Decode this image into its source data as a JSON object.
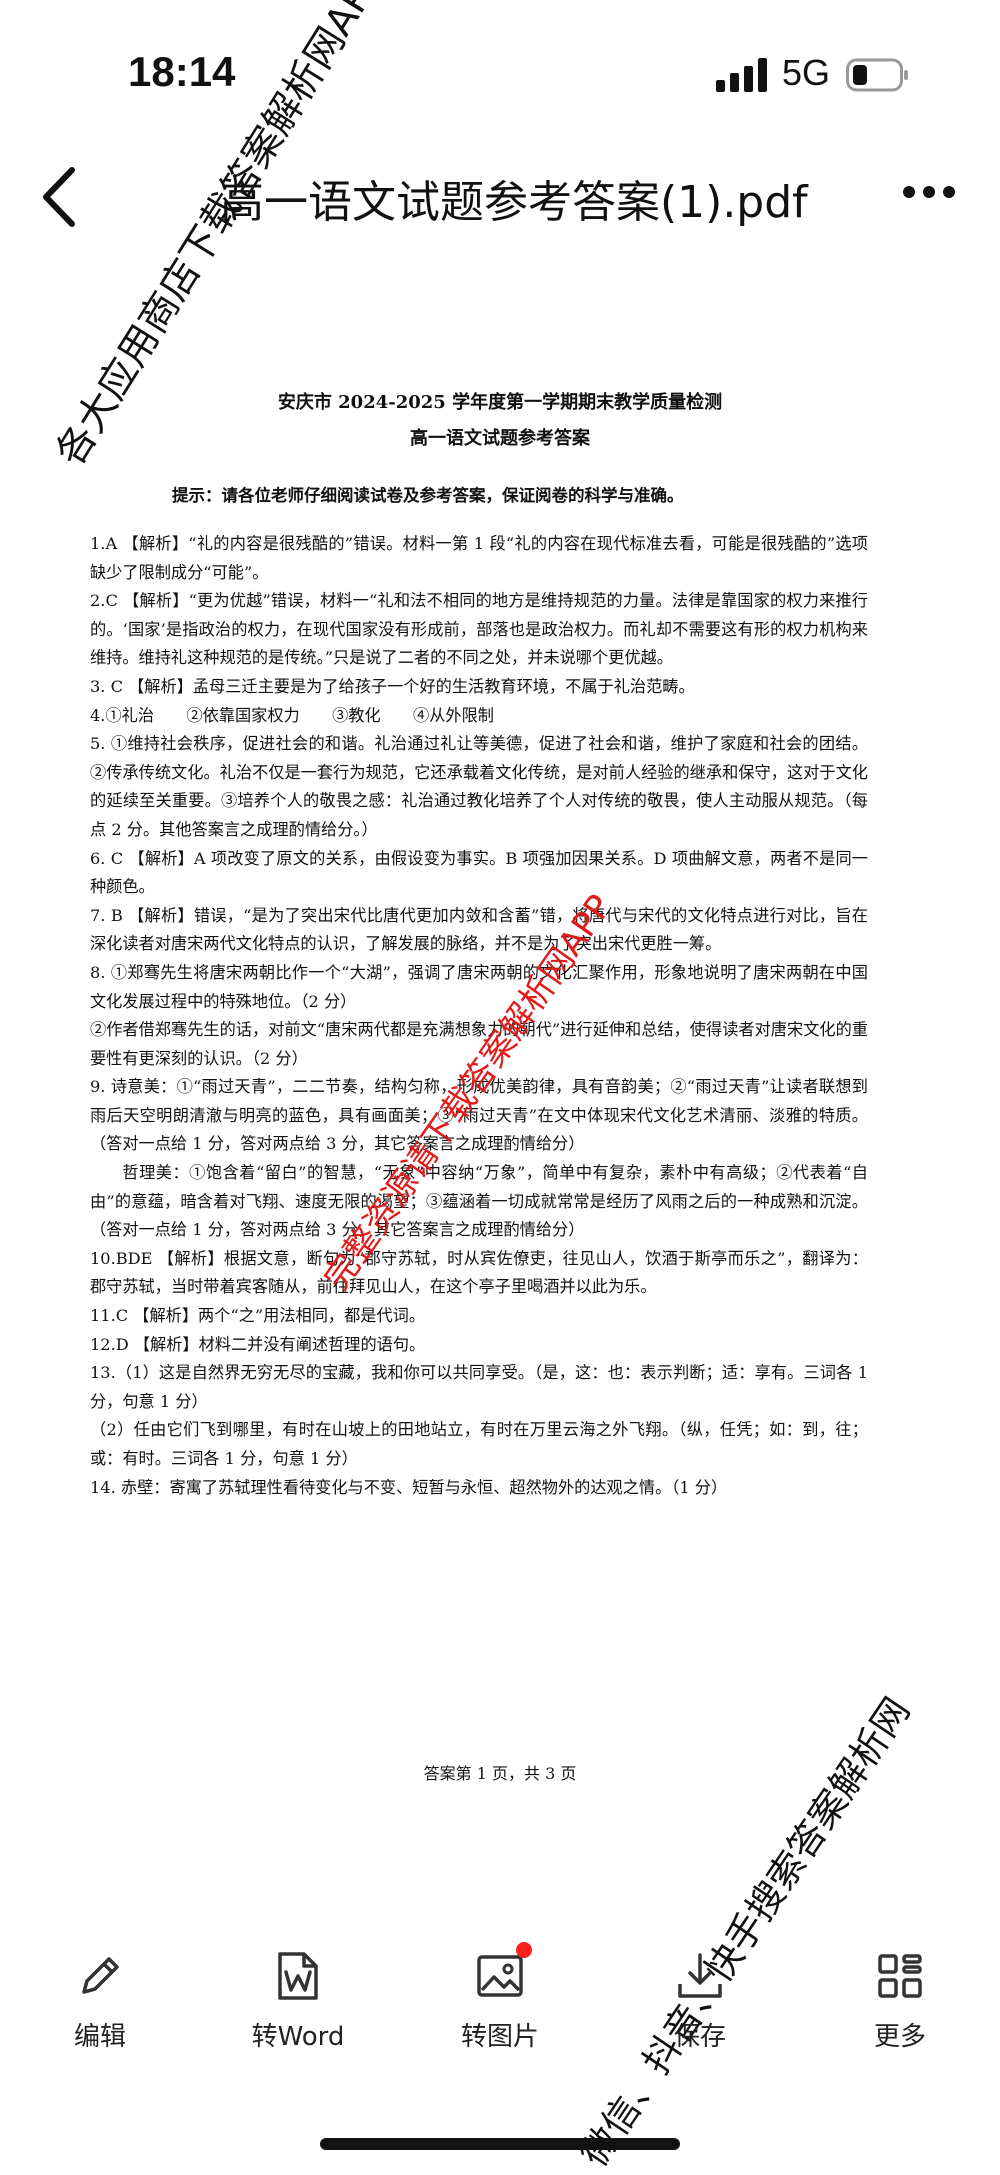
{
  "status_bar": {
    "time": "18:14",
    "network": "5G"
  },
  "header": {
    "title": "高一语文试题参考答案(1).pdf"
  },
  "document": {
    "heading1": "安庆市 2024-2025 学年度第一学期期末教学质量检测",
    "heading2": "高一语文试题参考答案",
    "tip": "提示：请各位老师仔细阅读试卷及参考答案，保证阅卷的科学与准确。",
    "paragraphs": [
      "1.A 【解析】“礼的内容是很残酷的”错误。材料一第 1 段“礼的内容在现代标准去看，可能是很残酷的”选项缺少了限制成分“可能”。",
      "2.C 【解析】“更为优越”错误，材料一“礼和法不相同的地方是维持规范的力量。法律是靠国家的权力来推行的。‘国家’是指政治的权力，在现代国家没有形成前，部落也是政治权力。而礼却不需要这有形的权力机构来维持。维持礼这种规范的是传统。”只是说了二者的不同之处，并未说哪个更优越。",
      "3. C 【解析】孟母三迁主要是为了给孩子一个好的生活教育环境，不属于礼治范畴。",
      "4.①礼治　　②依靠国家权力　　③教化　　④从外限制",
      "5. ①维持社会秩序，促进社会的和谐。礼治通过礼让等美德，促进了社会和谐，维护了家庭和社会的团结。②传承传统文化。礼治不仅是一套行为规范，它还承载着文化传统，是对前人经验的继承和保守，这对于文化的延续至关重要。③培养个人的敬畏之感：礼治通过教化培养了个人对传统的敬畏，使人主动服从规范。（每点 2 分。其他答案言之成理酌情给分。）",
      "6. C 【解析】A 项改变了原文的关系，由假设变为事实。B 项强加因果关系。D 项曲解文意，两者不是同一种颜色。",
      "7. B 【解析】错误，“是为了突出宋代比唐代更加内敛和含蓄”错，将唐代与宋代的文化特点进行对比，旨在深化读者对唐宋两代文化特点的认识，了解发展的脉络，并不是为了突出宋代更胜一筹。",
      "8. ①郑骞先生将唐宋两朝比作一个“大湖”，强调了唐宋两朝的文化汇聚作用，形象地说明了唐宋两朝在中国文化发展过程中的特殊地位。（2 分）",
      "②作者借郑骞先生的话，对前文“唐宋两代都是充满想象力的朝代”进行延伸和总结，使得读者对唐宋文化的重要性有更深刻的认识。（2 分）",
      "9. 诗意美：①“雨过天青”，二二节奏，结构匀称，形成优美韵律，具有音韵美；②“雨过天青”让读者联想到雨后天空明朗清澈与明亮的蓝色，具有画面美；③“雨过天青”在文中体现宋代文化艺术清丽、淡雅的特质。（答对一点给 1 分，答对两点给 3 分，其它答案言之成理酌情给分）",
      "哲理美：①饱含着“留白”的智慧，“无象”中容纳“万象”，简单中有复杂，素朴中有高级；②代表着“自由”的意蕴，暗含着对飞翔、速度无限的渴望；③蕴涵着一切成就常常是经历了风雨之后的一种成熟和沉淀。（答对一点给 1 分，答对两点给 3 分，其它答案言之成理酌情给分）",
      "10.BDE 【解析】根据文意，断句为“郡守苏轼，时从宾佐僚吏，往见山人，饮酒于斯亭而乐之”，翻译为：郡守苏轼，当时带着宾客随从，前往拜见山人，在这个亭子里喝酒并以此为乐。",
      "11.C 【解析】两个“之”用法相同，都是代词。",
      "12.D 【解析】材料二并没有阐述哲理的语句。",
      "13.（1）这是自然界无穷无尽的宝藏，我和你可以共同享受。（是，这：也：表示判断；适：享有。三词各 1 分，句意 1 分）",
      "（2）任由它们飞到哪里，有时在山坡上的田地站立，有时在万里云海之外飞翔。（纵，任凭；如：到，往；或：有时。三词各 1 分，句意 1 分）",
      "14. 赤壁：寄寓了苏轼理性看待变化与不变、短暂与永恒、超然物外的达观之情。（1 分）"
    ],
    "footer": "答案第 1 页，共 3 页"
  },
  "watermarks": {
    "left": "各大应用商店下载答案解析网APP",
    "center": "完整资源请下载答案解析网APP",
    "bottom": "微信、抖音、快手搜索答案解析网"
  },
  "toolbar": {
    "items": [
      {
        "label": "编辑",
        "icon": "pencil-icon"
      },
      {
        "label": "转Word",
        "icon": "word-icon"
      },
      {
        "label": "转图片",
        "icon": "image-icon"
      },
      {
        "label": "保存",
        "icon": "download-icon"
      },
      {
        "label": "更多",
        "icon": "grid-icon"
      }
    ]
  },
  "colors": {
    "accent_red": "#e11a1a",
    "badge_red": "#ff1f1f"
  }
}
